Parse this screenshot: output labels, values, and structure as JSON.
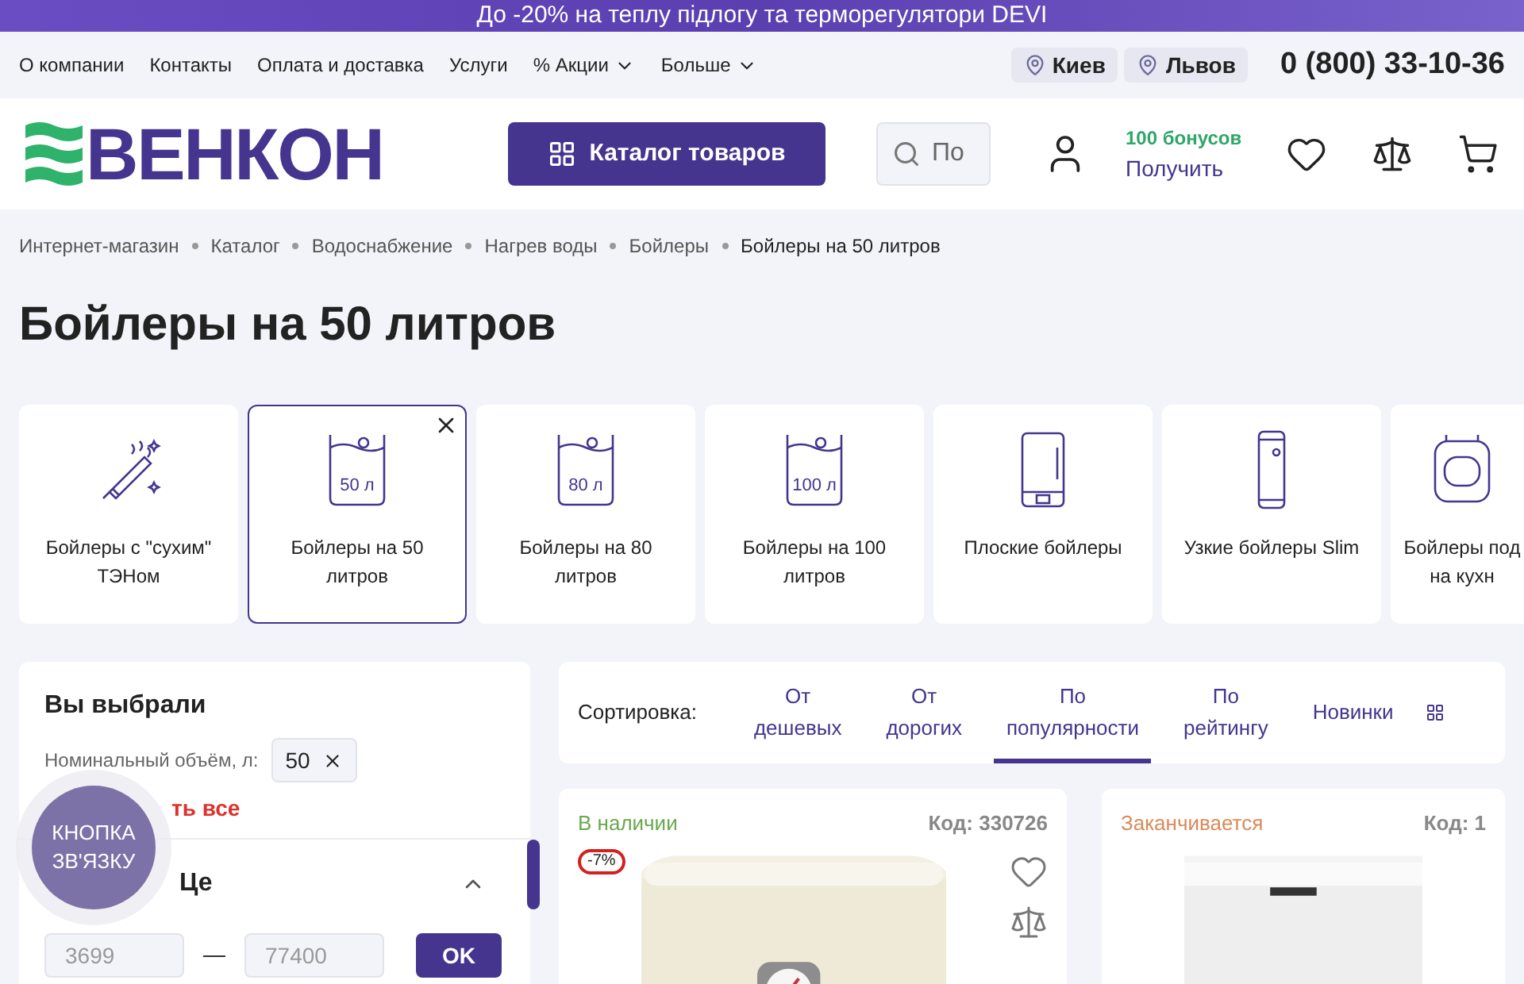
{
  "promo_banner": "До -20% на теплу підлогу та терморегулятори DEVI",
  "top_nav": [
    {
      "label": "О компании",
      "kind": "link"
    },
    {
      "label": "Контакты",
      "kind": "link"
    },
    {
      "label": "Оплата и доставка",
      "kind": "link"
    },
    {
      "label": "Услуги",
      "kind": "link"
    },
    {
      "label": "% Акции",
      "kind": "dropdown"
    },
    {
      "label": "Больше",
      "kind": "dropdown"
    }
  ],
  "cities": [
    "Киев",
    "Львов"
  ],
  "phone": "0 (800) 33-10-36",
  "logo": "ВЕНКОН",
  "catalog_button": "Каталог товаров",
  "search": {
    "placeholder": "По"
  },
  "bonus": {
    "amount": "100 бонусов",
    "action": "Получить"
  },
  "breadcrumbs": [
    "Интернет-магазин",
    "Каталог",
    "Водоснабжение",
    "Нагрев воды",
    "Бойлеры",
    "Бойлеры на 50 литров"
  ],
  "title": "Бойлеры на 50 литров",
  "categories": [
    {
      "label": "Бойлеры с \"сухим\" ТЭНом",
      "kind": "heater",
      "selected": false
    },
    {
      "label": "Бойлеры на 50 литров",
      "kind": "tank",
      "volume": "50 л",
      "selected": true
    },
    {
      "label": "Бойлеры на 80 литров",
      "kind": "tank",
      "volume": "80 л",
      "selected": false
    },
    {
      "label": "Бойлеры на 100 литров",
      "kind": "tank",
      "volume": "100 л",
      "selected": false
    },
    {
      "label": "Плоские бойлеры",
      "kind": "flat",
      "selected": false
    },
    {
      "label": "Узкие бойлеры Slim",
      "kind": "slim",
      "selected": false
    },
    {
      "label": "Бойлеры под на кухн",
      "kind": "kitchen",
      "selected": false
    }
  ],
  "filters": {
    "title": "Вы выбрали",
    "chips": [
      {
        "label": "Номинальный объём, л:",
        "value": "50"
      }
    ],
    "reset": "ть все"
  },
  "price_filter": {
    "title": "Це",
    "expanded": true,
    "min": "3699",
    "max": "77400",
    "button": "OK"
  },
  "contact_button": "КНОПКА ЗВ'ЯЗКУ",
  "sort": {
    "label": "Сортировка:",
    "options": [
      {
        "label": "От дешевых",
        "selected": false
      },
      {
        "label": "От дорогих",
        "selected": false
      },
      {
        "label": "По популярности",
        "selected": true
      },
      {
        "label": "По рейтингу",
        "selected": false
      },
      {
        "label": "Новинки",
        "selected": false
      }
    ]
  },
  "products": [
    {
      "availability": "В наличии",
      "kind": "in_stock",
      "code": "Код: 330726",
      "discount": "-7%"
    },
    {
      "availability": "Заканчивается",
      "kind": "low",
      "code": "Код: 1"
    }
  ]
}
